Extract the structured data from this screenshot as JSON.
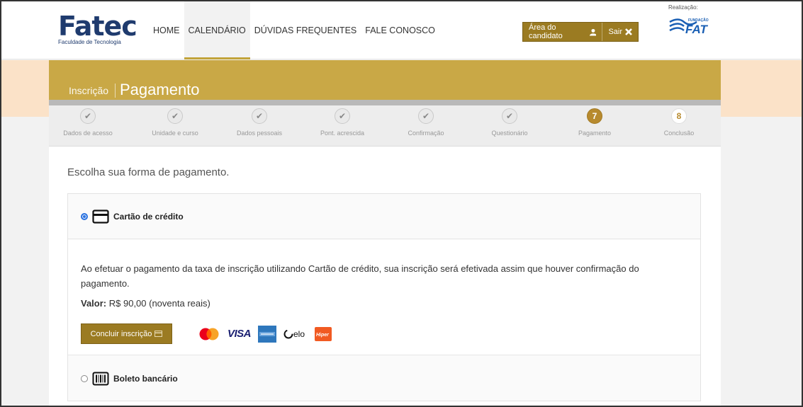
{
  "header": {
    "logo_text": "Fatec",
    "logo_subtext": "Faculdade de Tecnologia",
    "nav": [
      {
        "label": "HOME",
        "active": false
      },
      {
        "label": "CALENDÁRIO",
        "active": true
      },
      {
        "label": "DÚVIDAS FREQUENTES",
        "active": false
      },
      {
        "label": "FALE CONOSCO",
        "active": false
      }
    ],
    "candidate_area_label": "Área do candidato",
    "logout_label": "Sair",
    "realizacao_label": "Realização:",
    "fat_logo_small": "FUNDAÇÃO",
    "fat_logo_text": "FAT"
  },
  "title": {
    "section": "Inscrição",
    "page": "Pagamento"
  },
  "steps": [
    {
      "label": "Dados de acesso",
      "status": "done",
      "number": ""
    },
    {
      "label": "Unidade e curso",
      "status": "done",
      "number": ""
    },
    {
      "label": "Dados pessoais",
      "status": "done",
      "number": ""
    },
    {
      "label": "Pont. acrescida",
      "status": "done",
      "number": ""
    },
    {
      "label": "Confirmação",
      "status": "done",
      "number": ""
    },
    {
      "label": "Questionário",
      "status": "done",
      "number": ""
    },
    {
      "label": "Pagamento",
      "status": "current",
      "number": "7"
    },
    {
      "label": "Conclusão",
      "status": "next",
      "number": "8"
    }
  ],
  "main": {
    "choose_text": "Escolha sua forma de pagamento.",
    "credit": {
      "label": "Cartão de crédito",
      "selected": true,
      "description": "Ao efetuar o pagamento da taxa de inscrição utilizando Cartão de crédito, sua inscrição será efetivada assim que houver confirmação do pagamento.",
      "valor_label": "Valor:",
      "valor_text": "R$ 90,00 (noventa reais)",
      "button_label": "Concluir inscrição",
      "brands": [
        "mastercard",
        "VISA",
        "amex",
        "elo",
        "Hiper"
      ]
    },
    "boleto": {
      "label": "Boleto bancário",
      "selected": false
    }
  },
  "colors": {
    "gold": "#c9a846",
    "button": "#9b7b22",
    "navy": "#1f3b6e",
    "band": "#fbe2c8"
  }
}
